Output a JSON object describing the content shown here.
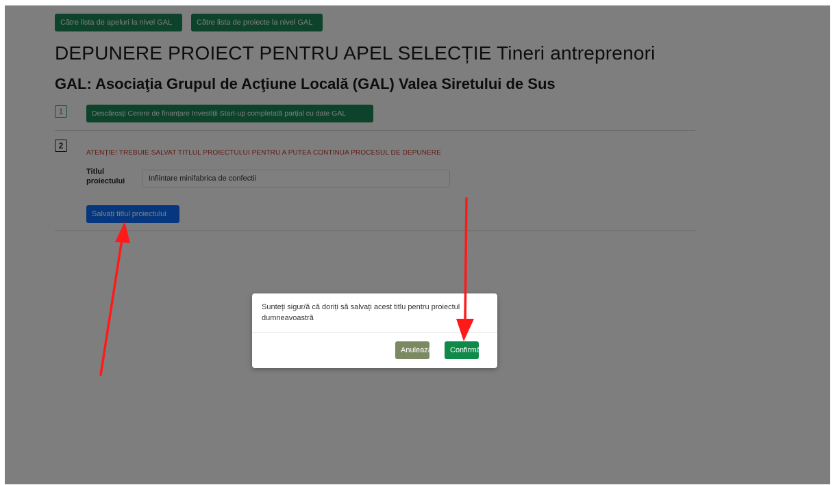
{
  "top_nav": {
    "calls_button": "Către lista de apeluri la nivel GAL",
    "projects_button": "Către lista de proiecte la nivel GAL"
  },
  "header": {
    "title": "DEPUNERE PROIECT PENTRU APEL SELECȚIE Tineri antreprenori",
    "gal_label": "GAL:",
    "gal_name": "Asociaţia Grupul de Acţiune Locală (GAL) Valea Siretului de Sus"
  },
  "step1": {
    "number": "1",
    "download_button": "Descărcați Cerere de finanțare Investiții Start-up completată parțial cu date GAL"
  },
  "step2": {
    "number": "2",
    "warning": "ATENȚIE! TREBUIE SALVAT TITLUL PROIECTULUI PENTRU A PUTEA CONTINUA PROCESUL DE DEPUNERE",
    "title_label": "Titlul proiectului",
    "title_value": "Infiintare minifabrica de confectii",
    "save_button": "Salvați titlul proiectului"
  },
  "dialog": {
    "message": "Sunteți sigur/ă că doriți să salvați acest titlu pentru proiectul dumneavoastră",
    "cancel_button": "Anulează",
    "confirm_button": "Confirmă"
  },
  "colors": {
    "primary_green": "#198754",
    "primary_blue": "#0d6efd",
    "warning_red": "#c0392b",
    "annotation_arrow": "#ff1a1a"
  }
}
